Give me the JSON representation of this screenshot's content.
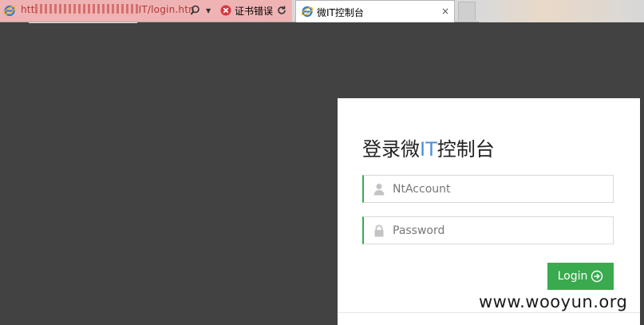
{
  "browser": {
    "url_prefix": "htt",
    "url_suffix": "IT/login.htn",
    "cert_error": "证书错误",
    "tab_title": "微IT控制台",
    "tab_close": "×"
  },
  "login": {
    "heading_part1": "登录微",
    "heading_it": "IT",
    "heading_part2": "控制台",
    "username_placeholder": "NtAccount",
    "password_placeholder": "Password",
    "login_label": "Login"
  },
  "watermark": "www.wooyun.org",
  "colors": {
    "accent": "#3aaa4e",
    "background": "#424242",
    "address_bar_error": "#f0b3b3",
    "it_blue": "#4a90d9"
  }
}
